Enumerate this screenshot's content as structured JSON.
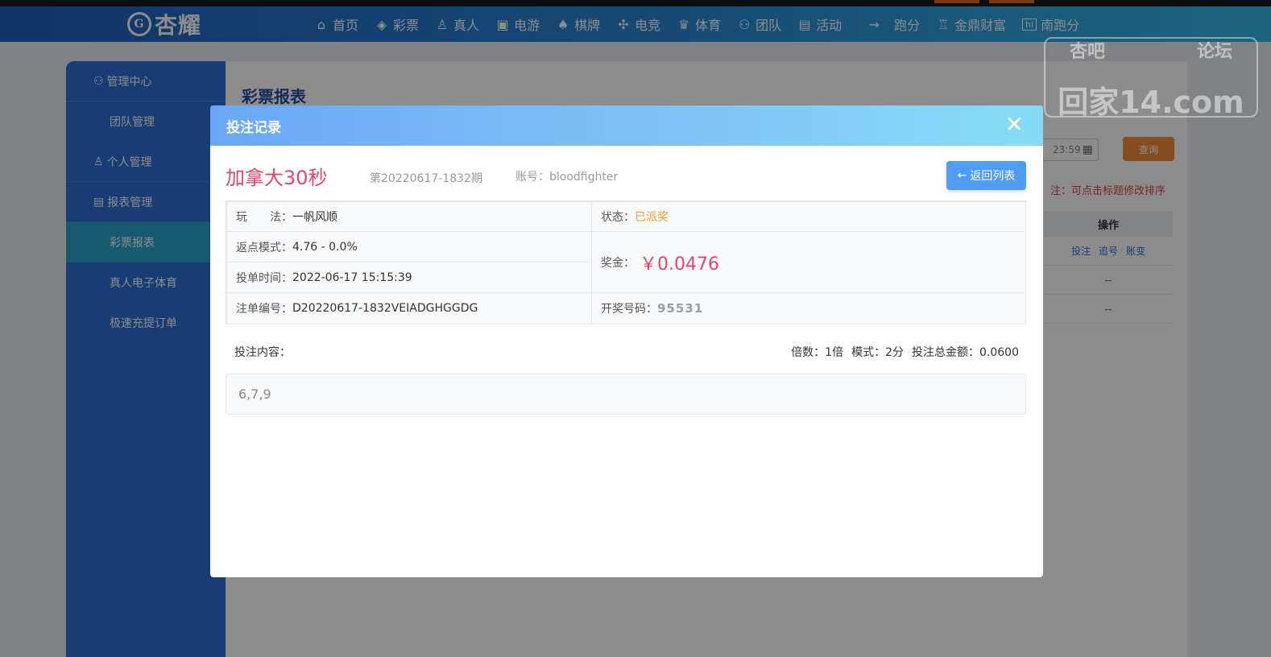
{
  "nav": {
    "logo_text": "杏耀",
    "items": [
      {
        "label": "首页",
        "icon": "home-icon"
      },
      {
        "label": "彩票",
        "icon": "ticket-icon"
      },
      {
        "label": "真人",
        "icon": "person-icon"
      },
      {
        "label": "电游",
        "icon": "game-machine-icon"
      },
      {
        "label": "棋牌",
        "icon": "cards-icon"
      },
      {
        "label": "电竞",
        "icon": "gamepad-icon"
      },
      {
        "label": "体育",
        "icon": "trophy-icon"
      },
      {
        "label": "团队",
        "icon": "team-icon"
      },
      {
        "label": "活动",
        "icon": "gift-icon"
      },
      {
        "label": "跑分",
        "icon": "car-icon"
      },
      {
        "label": "金鼎财富",
        "icon": "tripod-icon"
      },
      {
        "label": "南跑分",
        "icon": "hi-icon"
      }
    ]
  },
  "watermark": {
    "top_left": "杏吧",
    "top_right": "论坛",
    "main": "回家14.com"
  },
  "sidebar": {
    "sections": [
      {
        "label": "管理中心",
        "icon": "team-icon",
        "items": [
          "团队管理"
        ]
      },
      {
        "label": "个人管理",
        "icon": "user-icon",
        "items": []
      },
      {
        "label": "报表管理",
        "icon": "report-icon",
        "items": [
          "彩票报表",
          "真人电子体育",
          "极速充提订单"
        ]
      }
    ],
    "active_item": "彩票报表"
  },
  "page": {
    "title": "彩票报表",
    "date_fragment": "23:59",
    "query_button": "查询",
    "sort_note": "注：可点击标题修改排序",
    "column_header": "操作",
    "row_actions": [
      "投注",
      "追号",
      "账变"
    ],
    "empty_cell": "--"
  },
  "modal": {
    "title": "投注记录",
    "lottery_name": "加拿大30秒",
    "issue": "第20220617-1832期",
    "account_label": "账号：",
    "account_value": "bloodfighter",
    "back_button": "返回列表",
    "play_label": "玩　　法：",
    "play_value": "一帆风顺",
    "status_label": "状态：",
    "status_value": "已派奖",
    "rebate_label": "返点模式：",
    "rebate_value": "4.76 - 0.0%",
    "prize_label": "奖金：",
    "prize_value": "￥0.0476",
    "time_label": "投单时间：",
    "time_value": "2022-06-17 15:15:39",
    "order_label": "注单编号：",
    "order_value": "D20220617-1832VEIADGHGGDG",
    "draw_label": "开奖号码：",
    "draw_value": "95531",
    "content_label": "投注内容：",
    "multiple_label": "倍数：",
    "multiple_value": "1倍",
    "mode_label": "模式：",
    "mode_value": "2分",
    "total_label": "投注总金额：",
    "total_value": "0.0600",
    "bet_content": "6,7,9"
  },
  "colors": {
    "accent": "#4f9cf4",
    "lottery_name": "#e0476b",
    "status": "#f0a020",
    "navbar": "#2a8ad6"
  }
}
